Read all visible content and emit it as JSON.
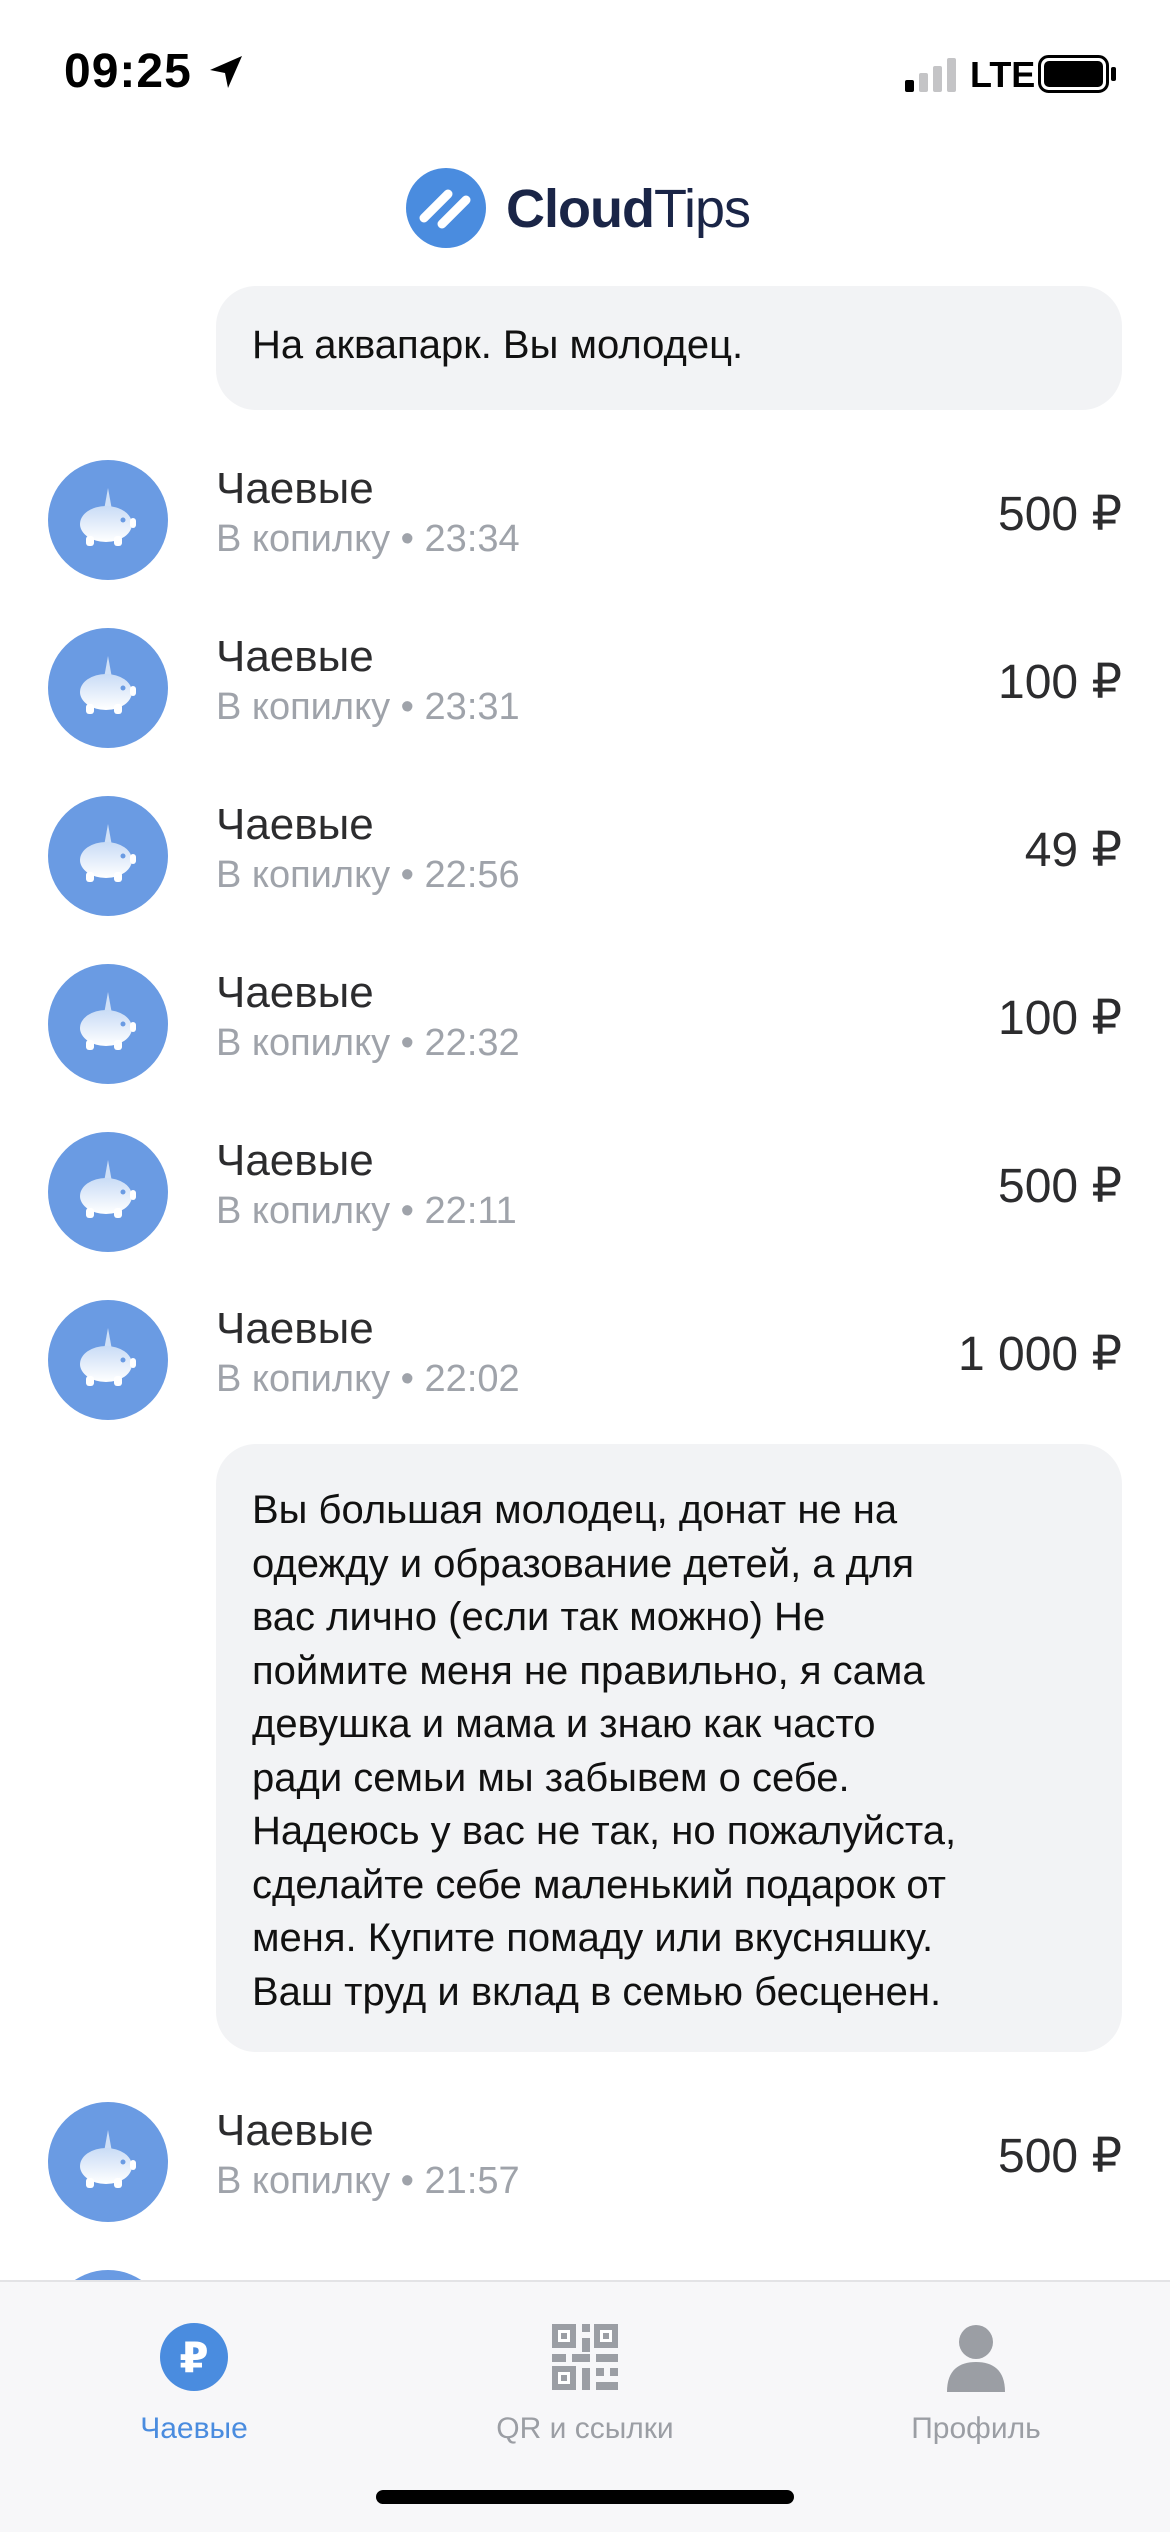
{
  "status_bar": {
    "time": "09:25",
    "network": "LTE",
    "icons": [
      "location-arrow-icon",
      "signal-icon",
      "battery-icon"
    ]
  },
  "header": {
    "brand_part1": "Cloud",
    "brand_part2": "Tips",
    "brand_color": "#1a2547",
    "logo_color": "#4a8cdf"
  },
  "feed": {
    "message_top": "На аквапарк. Вы молодец.",
    "transactions": [
      {
        "title": "Чаевые",
        "destination": "В копилку",
        "time": "23:34",
        "amount": "500 ₽",
        "icon": "piggy-bank-icon"
      },
      {
        "title": "Чаевые",
        "destination": "В копилку",
        "time": "23:31",
        "amount": "100 ₽",
        "icon": "piggy-bank-icon"
      },
      {
        "title": "Чаевые",
        "destination": "В копилку",
        "time": "22:56",
        "amount": "49 ₽",
        "icon": "piggy-bank-icon"
      },
      {
        "title": "Чаевые",
        "destination": "В копилку",
        "time": "22:32",
        "amount": "100 ₽",
        "icon": "piggy-bank-icon"
      },
      {
        "title": "Чаевые",
        "destination": "В копилку",
        "time": "22:11",
        "amount": "500 ₽",
        "icon": "piggy-bank-icon"
      },
      {
        "title": "Чаевые",
        "destination": "В копилку",
        "time": "22:02",
        "amount": "1 000 ₽",
        "icon": "piggy-bank-icon"
      },
      {
        "title": "Чаевые",
        "destination": "В копилку",
        "time": "21:57",
        "amount": "500 ₽",
        "icon": "piggy-bank-icon"
      }
    ],
    "message_long_lines": [
      "Вы большая молодец, донат не на",
      "одежду и образование детей, а для",
      "вас лично (если так можно) Не",
      "поймите меня не правильно, я сама",
      "девушка и мама и знаю как часто",
      "ради семьи мы забывем о себе.",
      "Надеюсь у вас не так, но пожалуйста,",
      "сделайте себе маленький подарок от",
      "меня. Купите помаду или вкусняшку.",
      "Ваш труд и вклад в семью бесценен."
    ]
  },
  "tab_bar": {
    "tabs": [
      {
        "label": "Чаевые",
        "icon": "ruble-icon",
        "active": true
      },
      {
        "label": "QR и ссылки",
        "icon": "qr-code-icon",
        "active": false
      },
      {
        "label": "Профиль",
        "icon": "profile-icon",
        "active": false
      }
    ],
    "active_color": "#4a8cdf",
    "inactive_color": "#9b9ea4"
  }
}
